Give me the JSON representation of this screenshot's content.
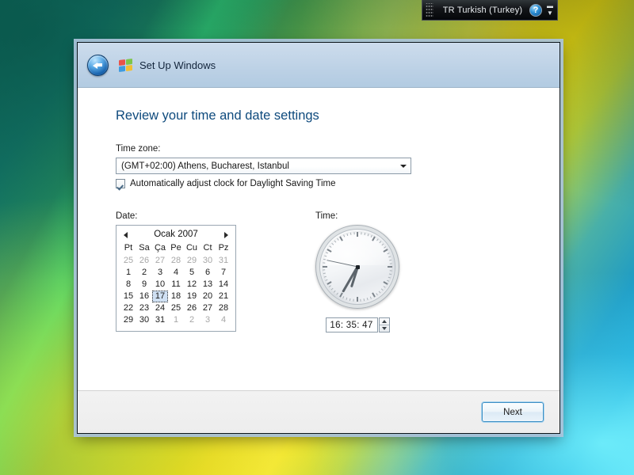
{
  "language_bar": {
    "grip": "drag-grip",
    "label": "TR Turkish (Turkey)",
    "help_glyph": "?",
    "minimize_glyph": "▬",
    "dropdown_glyph": "▼"
  },
  "window": {
    "title": "Set Up Windows",
    "back_label": "Back",
    "flag_icon": "windows-flag-icon"
  },
  "page": {
    "heading": "Review your time and date settings",
    "timezone_label": "Time zone:",
    "timezone_value": "(GMT+02:00) Athens, Bucharest, Istanbul",
    "dst_label": "Automatically adjust clock for Daylight Saving Time",
    "dst_checked": true,
    "date_label": "Date:",
    "time_label": "Time:"
  },
  "calendar": {
    "month_title": "Ocak 2007",
    "prev_glyph": "◀",
    "next_glyph": "▶",
    "day_headers": [
      "Pt",
      "Sa",
      "Ça",
      "Pe",
      "Cu",
      "Ct",
      "Pz"
    ],
    "selected_day": 17,
    "weeks": [
      [
        {
          "n": "25",
          "out": true
        },
        {
          "n": "26",
          "out": true
        },
        {
          "n": "27",
          "out": true
        },
        {
          "n": "28",
          "out": true
        },
        {
          "n": "29",
          "out": true
        },
        {
          "n": "30",
          "out": true
        },
        {
          "n": "31",
          "out": true
        }
      ],
      [
        {
          "n": "1"
        },
        {
          "n": "2"
        },
        {
          "n": "3"
        },
        {
          "n": "4"
        },
        {
          "n": "5"
        },
        {
          "n": "6"
        },
        {
          "n": "7"
        }
      ],
      [
        {
          "n": "8"
        },
        {
          "n": "9"
        },
        {
          "n": "10"
        },
        {
          "n": "11"
        },
        {
          "n": "12"
        },
        {
          "n": "13"
        },
        {
          "n": "14"
        }
      ],
      [
        {
          "n": "15"
        },
        {
          "n": "16"
        },
        {
          "n": "17",
          "sel": true
        },
        {
          "n": "18"
        },
        {
          "n": "19"
        },
        {
          "n": "20"
        },
        {
          "n": "21"
        }
      ],
      [
        {
          "n": "22"
        },
        {
          "n": "23"
        },
        {
          "n": "24"
        },
        {
          "n": "25"
        },
        {
          "n": "26"
        },
        {
          "n": "27"
        },
        {
          "n": "28"
        }
      ],
      [
        {
          "n": "29"
        },
        {
          "n": "30"
        },
        {
          "n": "31"
        },
        {
          "n": "1",
          "out": true
        },
        {
          "n": "2",
          "out": true
        },
        {
          "n": "3",
          "out": true
        },
        {
          "n": "4",
          "out": true
        }
      ]
    ]
  },
  "clock": {
    "display_value": "16: 35: 47",
    "hours": 16,
    "minutes": 35,
    "seconds": 47,
    "hour_angle": 197.5,
    "minute_angle": 210,
    "second_angle": 282
  },
  "footer": {
    "next_label": "Next"
  },
  "colors": {
    "heading": "#0e4a7d",
    "titlebar": "#c2d5e8",
    "selection": "#cfe0f3",
    "accent_button_border": "#3d8fc4"
  }
}
